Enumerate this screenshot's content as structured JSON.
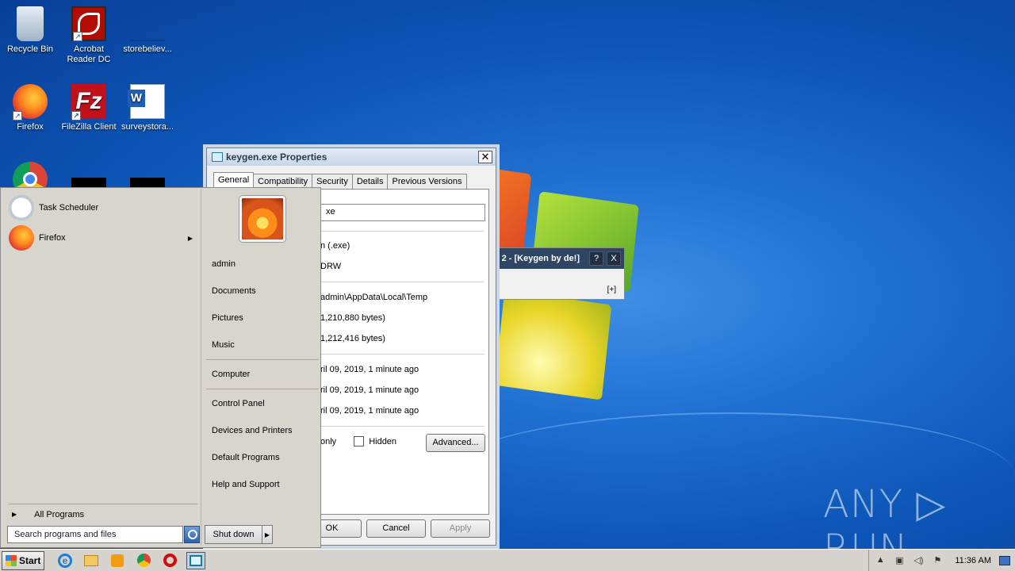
{
  "desktop": {
    "icons": [
      {
        "label": "Recycle Bin",
        "icon": "recycle-bin-icon"
      },
      {
        "label": "Acrobat Reader DC",
        "icon": "acrobat-icon"
      },
      {
        "label": "storebeliev...",
        "icon": "file-icon"
      },
      {
        "label": "Firefox",
        "icon": "firefox-icon"
      },
      {
        "label": "FileZilla Client",
        "icon": "filezilla-icon"
      },
      {
        "label": "surveystora...",
        "icon": "word-doc-icon"
      }
    ],
    "watermark": "ANY ▷ RUN"
  },
  "properties_dialog": {
    "title": "keygen.exe Properties",
    "tabs": [
      "General",
      "Compatibility",
      "Security",
      "Details",
      "Previous Versions"
    ],
    "active_tab": "General",
    "file_name": "xe",
    "type": "n (.exe)",
    "opens_with": "DRW",
    "location": "admin\\AppData\\Local\\Temp",
    "size": "1,210,880 bytes)",
    "size_on_disk": "1,212,416 bytes)",
    "created": "ril 09, 2019, 1 minute ago",
    "modified": "ril 09, 2019, 1 minute ago",
    "accessed": "ril 09, 2019, 1 minute ago",
    "readonly_label": "only",
    "hidden_label": "Hidden",
    "advanced_label": "Advanced...",
    "ok_label": "OK",
    "cancel_label": "Cancel",
    "apply_label": "Apply"
  },
  "keygen_window": {
    "title": "2 - [Keygen  by de!]",
    "help_label": "?",
    "close_label": "X",
    "expand_label": "[+]"
  },
  "start_menu": {
    "programs": [
      {
        "label": "Task Scheduler",
        "icon": "clock-icon"
      },
      {
        "label": "Firefox",
        "icon": "firefox-icon"
      }
    ],
    "all_programs": "All Programs",
    "search_placeholder": "Search programs and files",
    "right_links": [
      "admin",
      "Documents",
      "Pictures",
      "Music",
      "Computer",
      "Control Panel",
      "Devices and Printers",
      "Default Programs",
      "Help and Support"
    ],
    "shutdown_label": "Shut down"
  },
  "taskbar": {
    "start_label": "Start",
    "clock": "11:36 AM"
  }
}
